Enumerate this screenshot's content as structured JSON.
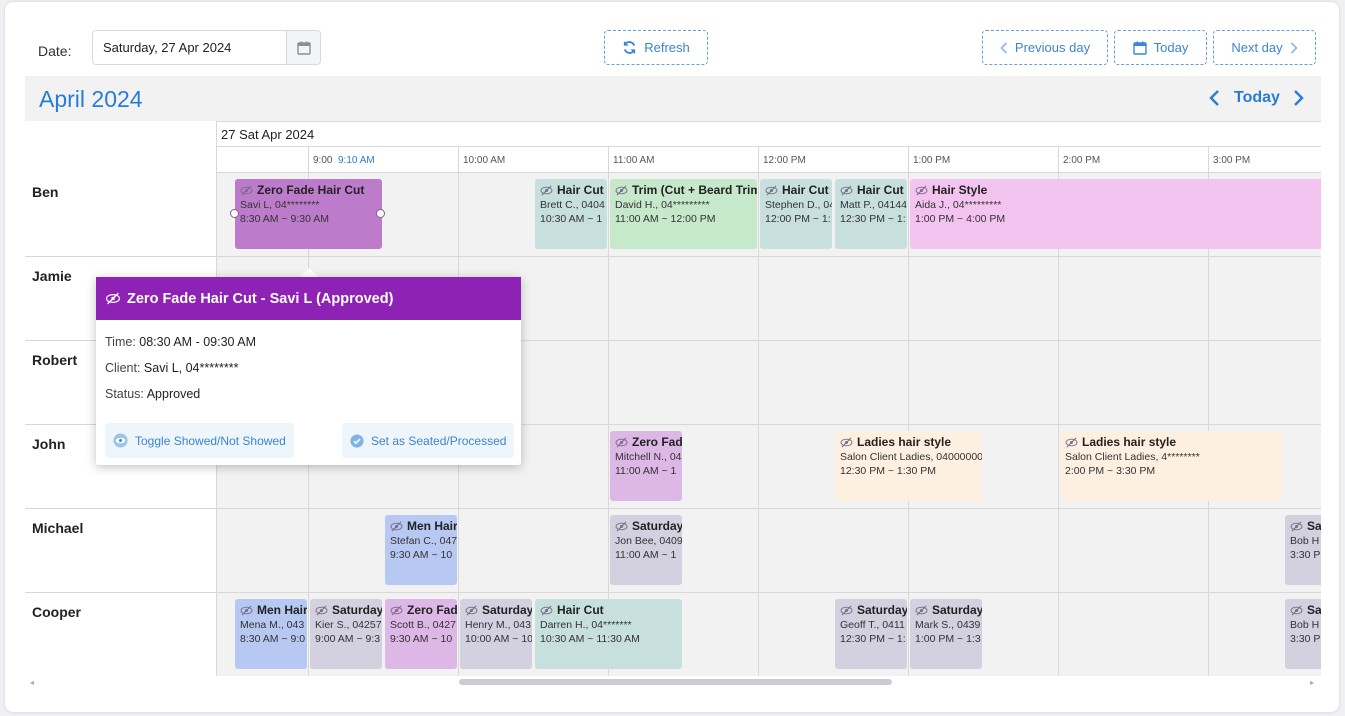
{
  "toolbar": {
    "date_label": "Date:",
    "date_value": "Saturday, 27 Apr 2024",
    "refresh_label": "Refresh",
    "previous_day_label": "Previous day",
    "today_label": "Today",
    "next_day_label": "Next day"
  },
  "calendar": {
    "month_title": "April 2024",
    "nav_today_label": "Today",
    "day_header": "27 Sat Apr 2024",
    "time_slots": [
      "9:00",
      "10:00 AM",
      "11:00 AM",
      "12:00 PM",
      "1:00 PM",
      "2:00 PM",
      "3:00 PM"
    ],
    "now_label": "9:10 AM",
    "resources": [
      "Ben",
      "Jamie",
      "Robert",
      "John",
      "Michael",
      "Cooper"
    ]
  },
  "events": [
    {
      "title": "Zero Fade Hair Cut",
      "client": "Savi L, 04********",
      "time": "8:30 AM ~ 9:30 AM"
    },
    {
      "title": "Hair Cut",
      "client": "Brett C., 0404",
      "time": "10:30 AM ~ 1"
    },
    {
      "title": "Trim (Cut + Beard Trim)",
      "client": "David H., 04*********",
      "time": "11:00 AM ~ 12:00 PM"
    },
    {
      "title": "Hair Cut",
      "client": "Stephen D., 04",
      "time": "12:00 PM ~ 1:"
    },
    {
      "title": "Hair Cut",
      "client": "Matt P., 04144",
      "time": "12:30 PM ~ 1:"
    },
    {
      "title": "Hair Style",
      "client": "Aida J., 04*********",
      "time": "1:00 PM ~ 4:00 PM"
    },
    {
      "title": "Zero Fade",
      "client": "Mitchell N., 04",
      "time": "11:00 AM ~ 1"
    },
    {
      "title": "Ladies hair style",
      "client": "Salon Client Ladies, 04000000",
      "time": "12:30 PM ~ 1:30 PM"
    },
    {
      "title": "Ladies hair style",
      "client": "Salon Client Ladies, 4********",
      "time": "2:00 PM ~ 3:30 PM"
    },
    {
      "title": "Men Hair",
      "client": "Stefan C., 047",
      "time": "9:30 AM ~ 10"
    },
    {
      "title": "Saturday",
      "client": "Jon Bee, 0409",
      "time": "11:00 AM ~ 1"
    },
    {
      "title": "Sa",
      "client": "Bob H",
      "time": "3:30 P"
    },
    {
      "title": "Men Hair",
      "client": "Mena M., 043",
      "time": "8:30 AM ~ 9:0"
    },
    {
      "title": "Saturday",
      "client": "Kier S., 04257",
      "time": "9:00 AM ~ 9:3"
    },
    {
      "title": "Zero Fad",
      "client": "Scott B., 0427",
      "time": "9:30 AM ~ 10"
    },
    {
      "title": "Saturday",
      "client": "Henry M., 043",
      "time": "10:00 AM ~ 10"
    },
    {
      "title": "Hair Cut",
      "client": "Darren H., 04*******",
      "time": "10:30 AM ~ 11:30 AM"
    },
    {
      "title": "Saturday",
      "client": "Geoff T., 0411",
      "time": "12:30 PM ~ 1:"
    },
    {
      "title": "Saturday",
      "client": "Mark S., 0439",
      "time": "1:00 PM ~ 1:3"
    },
    {
      "title": "Sa",
      "client": "Bob H",
      "time": "3:30 P"
    }
  ],
  "popover": {
    "title": "Zero Fade Hair Cut - Savi L (Approved)",
    "time_label": "Time:",
    "time_value": "08:30 AM - 09:30 AM",
    "client_label": "Client:",
    "client_value": "Savi L, 04********",
    "status_label": "Status:",
    "status_value": "Approved",
    "toggle_label": "Toggle Showed/Not Showed",
    "seated_label": "Set as Seated/Processed"
  },
  "colors": {
    "accent": "#2a7cd3",
    "popover_header": "#8e22b4"
  }
}
